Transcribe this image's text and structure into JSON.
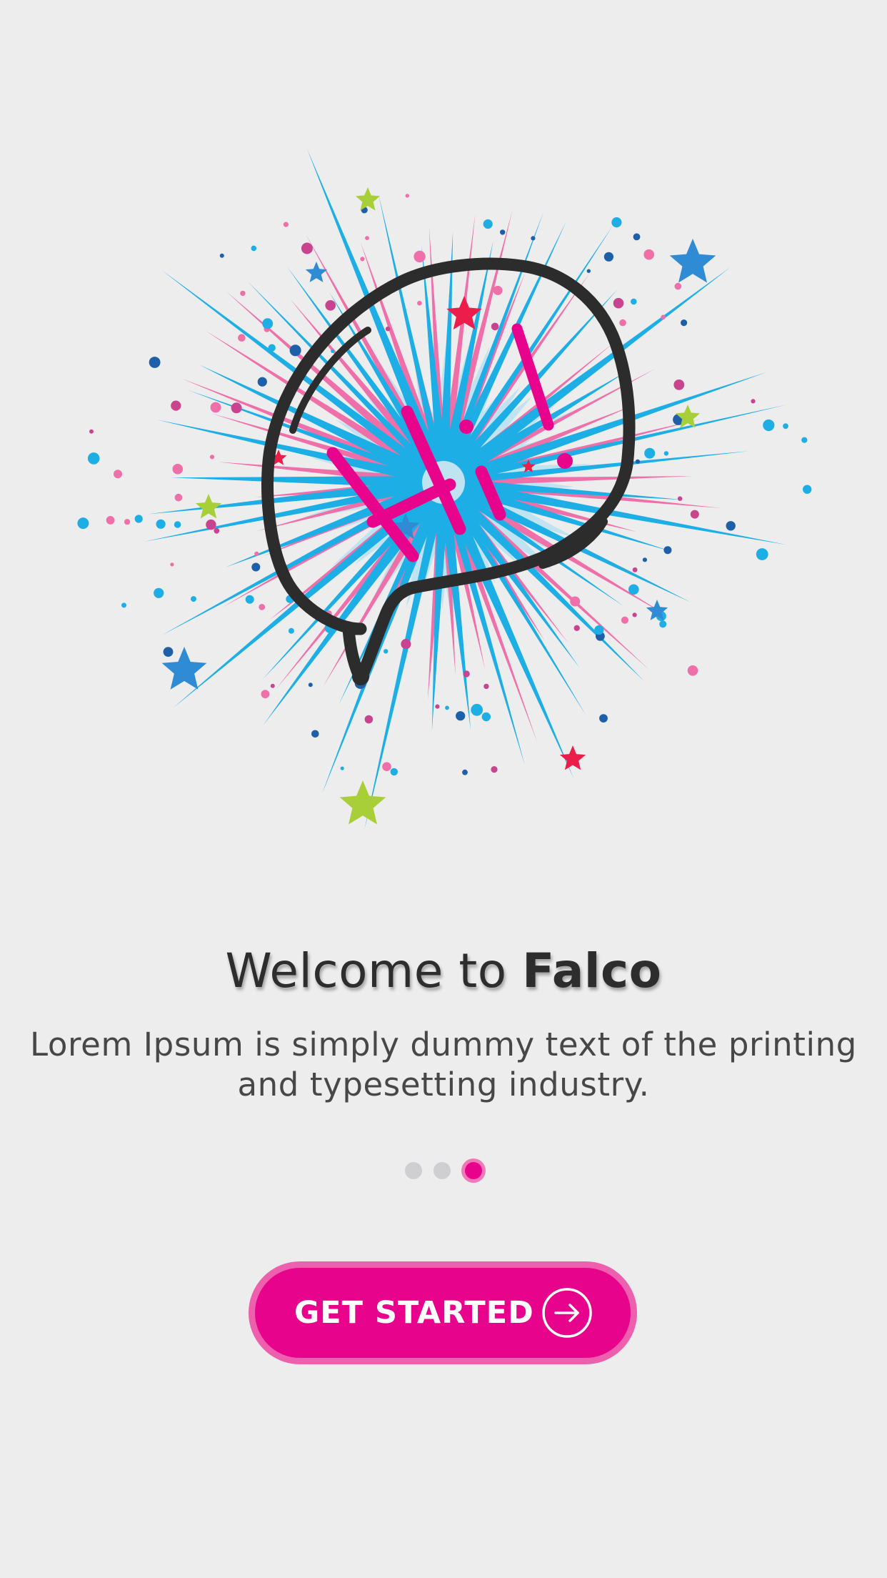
{
  "onboarding": {
    "title_prefix": "Welcome to ",
    "title_brand": "Falco",
    "description": "Lorem Ipsum is simply dummy text of the printing and typesetting industry.",
    "pagination": {
      "total_pages": 3,
      "current_page": 3
    },
    "cta": {
      "label": "GET STARTED",
      "icon": "arrow-right-circle-icon"
    },
    "illustration": {
      "bubble_text": "Hi!",
      "icons": [
        "speech-bubble-icon",
        "burst-rays",
        "star-icon",
        "confetti-dots"
      ]
    }
  },
  "theme": {
    "background": "#ededee",
    "accent": "#e8038c",
    "accent_light": "#ee5fae",
    "text_dark": "#2d2d2d",
    "text_body": "#474747",
    "dot_inactive": "#cfcfd1",
    "burst_blue": "#1eaee6",
    "burst_pink": "#ef6fa8",
    "burst_glow": "#bfe3f0",
    "star_green": "#a9cf38",
    "star_blue": "#2f8bd4",
    "star_red": "#ec1c4b"
  }
}
